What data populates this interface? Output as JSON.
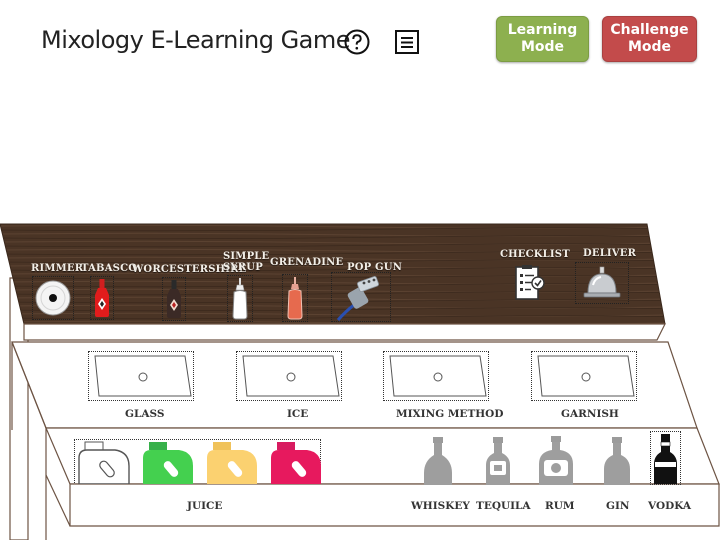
{
  "header": {
    "title": "Mixology E-Learning Game",
    "learning_mode": "Learning\nMode",
    "challenge_mode": "Challenge\nMode",
    "colors": {
      "learning": "#8db04f",
      "challenge": "#c34b4b",
      "wood": "#4b3526"
    }
  },
  "bar_top": {
    "items": [
      "RIMMER",
      "TABASCO",
      "WORCESTERSHIRE",
      "SIMPLE SYRUP",
      "GRENADINE",
      "POP GUN"
    ],
    "checklist": "CHECKLIST",
    "deliver": "DELIVER"
  },
  "middle_shelf": {
    "slots": [
      "GLASS",
      "ICE",
      "MIXING METHOD",
      "GARNISH"
    ]
  },
  "bottom_shelf": {
    "juice": "JUICE",
    "spirits": [
      "WHISKEY",
      "TEQUILA",
      "RUM",
      "GIN",
      "VODKA"
    ]
  }
}
